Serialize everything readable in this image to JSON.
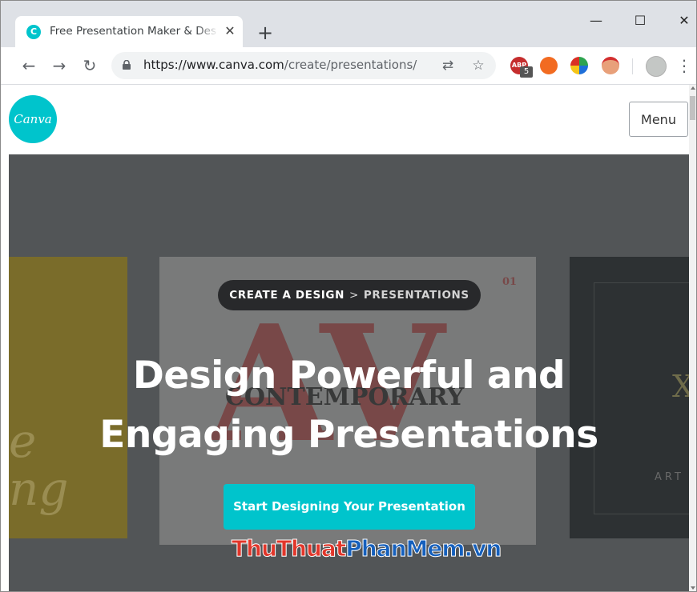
{
  "browser": {
    "tab_title": "Free Presentation Maker & Design",
    "tab_favicon": "C",
    "new_tab": "+",
    "close_tab": "✕",
    "window_controls": {
      "minimize": "—",
      "maximize": "☐",
      "close": "✕"
    },
    "url_host": "https://www.canva.com",
    "url_path": "/create/presentations/",
    "extensions": [
      {
        "icon": "abp-icon",
        "label": "ABP",
        "badge": "5"
      },
      {
        "icon": "hola-icon"
      },
      {
        "icon": "idm-icon"
      },
      {
        "icon": "santa-icon"
      }
    ]
  },
  "site": {
    "logo_text": "Canva",
    "menu_label": "Menu"
  },
  "hero": {
    "breadcrumb_1": "CREATE A DESIGN",
    "breadcrumb_sep": ">",
    "breadcrumb_2": "PRESENTATIONS",
    "title_line_1": "Design Powerful and",
    "title_line_2": "Engaging Presentations",
    "cta_label": "Start Designing Your Presentation",
    "background_cards": {
      "yellow_text": "e\nng",
      "white_big": "AV",
      "white_text": "CONTEMPORARY",
      "white_number": "01",
      "dark_letter": "X",
      "dark_text": "ART"
    }
  },
  "watermark": {
    "part_1": "Thu",
    "part_2": "Thuat",
    "part_3": "Phan",
    "part_4": "Mem",
    "part_5": ".vn"
  },
  "colors": {
    "accent": "#00c4cc",
    "hero_bg": "#5c5e61",
    "breadcrumb_bg": "#28292b"
  }
}
